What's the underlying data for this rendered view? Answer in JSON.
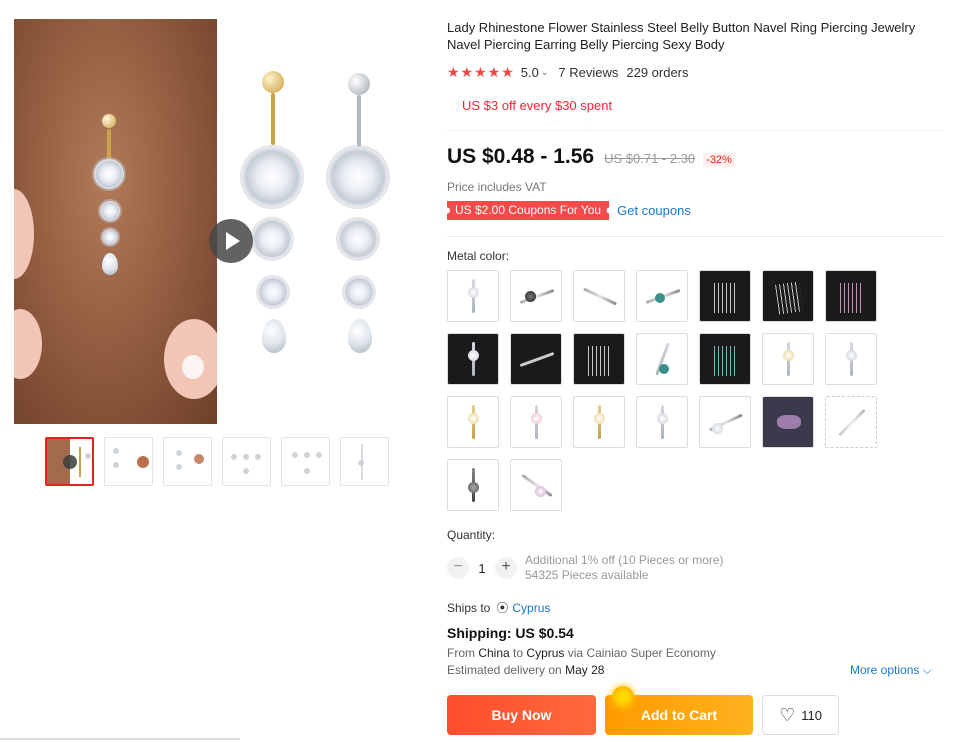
{
  "product": {
    "title": "Lady Rhinestone Flower Stainless Steel Belly Button Navel Ring Piercing Jewelry Navel Piercing Earring Belly Piercing Sexy Body",
    "rating": {
      "stars": "★★★★★",
      "score": "5.0",
      "caret": "⌄",
      "reviews": "7 Reviews",
      "orders": "229 orders"
    },
    "promo": "US $3 off every $30 spent",
    "price": {
      "current": "US $0.48 - 1.56",
      "original": "US $0.71 - 2.30",
      "discount": "-32%"
    },
    "vat_note": "Price includes VAT",
    "coupon": {
      "tag": "US $2.00 Coupons For You",
      "link": "Get coupons"
    }
  },
  "variants": {
    "label": "Metal color:",
    "count": 23
  },
  "quantity": {
    "label": "Quantity:",
    "minus": "−",
    "value": "1",
    "plus": "+",
    "discount_note": "Additional 1% off (10 Pieces or more)",
    "available": "54325 Pieces available"
  },
  "shipping": {
    "ships_to_label": "Ships to",
    "ships_to_country": "Cyprus",
    "pin_icon": "⦿",
    "title": "Shipping: US $0.54",
    "from_prefix": "From",
    "from": "China",
    "to_word": "to",
    "to": "Cyprus",
    "via": "via Cainiao Super Economy",
    "delivery_prefix": "Estimated delivery on",
    "delivery_date": "May 28",
    "more_options": "More options ⌵"
  },
  "actions": {
    "buy_now": "Buy Now",
    "add_to_cart": "Add to Cart",
    "wishlist_icon": "♡",
    "wishlist_count": "110"
  },
  "colors": {
    "price_red": "#e1251b",
    "link_blue": "#1a77c9",
    "buy_now": "#ff4d2d",
    "add_to_cart": "#ffa000",
    "star_red": "#f44646"
  }
}
